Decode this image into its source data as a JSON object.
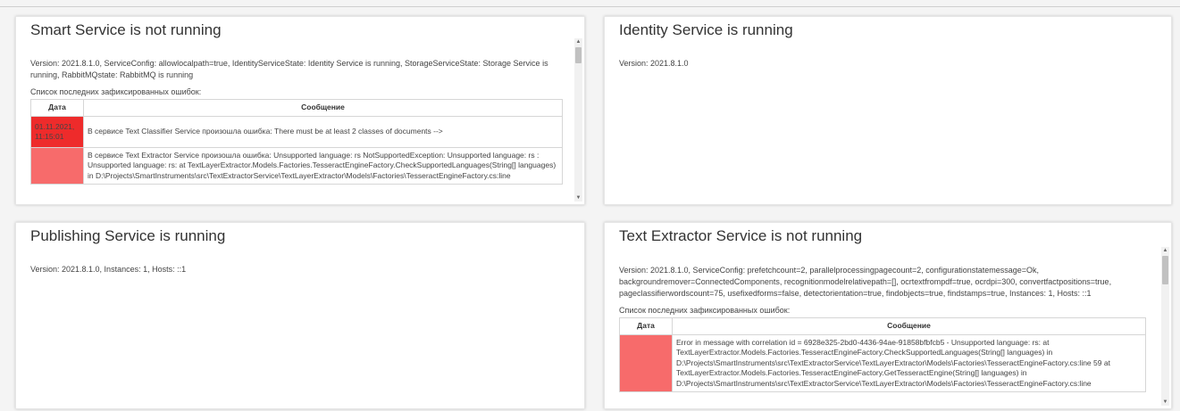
{
  "cards": [
    {
      "title": "Smart Service is not running",
      "version_text": "Version: 2021.8.1.0, ServiceConfig: allowlocalpath=true, IdentityServiceState: Identity Service is running, StorageServiceState: Storage Service is running, RabbitMQstate: RabbitMQ is running",
      "errors_label": "Список последних зафиксированных ошибок:",
      "table": {
        "col_date": "Дата",
        "col_message": "Сообщение",
        "rows": [
          {
            "date": "01.11.2021, 11:15:01",
            "message": "В сервисе Text Classifier Service произошла ошибка: There must be at least 2 classes of documents -->"
          },
          {
            "date": "",
            "message": "В сервисе Text Extractor Service произошла ошибка: Unsupported language: rs NotSupportedException: Unsupported language: rs : Unsupported language: rs: at TextLayerExtractor.Models.Factories.TesseractEngineFactory.CheckSupportedLanguages(String[] languages) in D:\\Projects\\SmartInstruments\\src\\TextExtractorService\\TextLayerExtractor\\Models\\Factories\\TesseractEngineFactory.cs:line"
          }
        ]
      }
    },
    {
      "title": "Identity Service is running",
      "version_text": "Version: 2021.8.1.0"
    },
    {
      "title": "Publishing Service is running",
      "version_text": "Version: 2021.8.1.0, Instances: 1, Hosts: ::1"
    },
    {
      "title": "Text Extractor Service is not running",
      "version_text": "Version: 2021.8.1.0, ServiceConfig: prefetchcount=2, parallelprocessingpagecount=2, configurationstatemessage=Ok, backgroundremover=ConnectedComponents, recognitionmodelrelativepath=[], ocrtextfrompdf=true, ocrdpi=300, convertfactpositions=true, pageclassifierwordscount=75, usefixedforms=false, detectorientation=true, findobjects=true, findstamps=true, Instances: 1, Hosts: ::1",
      "errors_label": "Список последних зафиксированных ошибок:",
      "table": {
        "col_date": "Дата",
        "col_message": "Сообщение",
        "rows": [
          {
            "date": "",
            "message": "Error in message with correlation id = 6928e325-2bd0-4436-94ae-91858bfbfcb5 - Unsupported language: rs: at TextLayerExtractor.Models.Factories.TesseractEngineFactory.CheckSupportedLanguages(String[] languages) in D:\\Projects\\SmartInstruments\\src\\TextExtractorService\\TextLayerExtractor\\Models\\Factories\\TesseractEngineFactory.cs:line 59 at TextLayerExtractor.Models.Factories.TesseractEngineFactory.GetTesseractEngine(String[] languages) in D:\\Projects\\SmartInstruments\\src\\TextExtractorService\\TextLayerExtractor\\Models\\Factories\\TesseractEngineFactory.cs:line"
          }
        ]
      }
    }
  ],
  "colors": {
    "error_date_dark": "#ee2b2b",
    "error_date_light": "#f76b6b",
    "card_background": "#ffffff",
    "page_background": "#f4f4f4"
  }
}
